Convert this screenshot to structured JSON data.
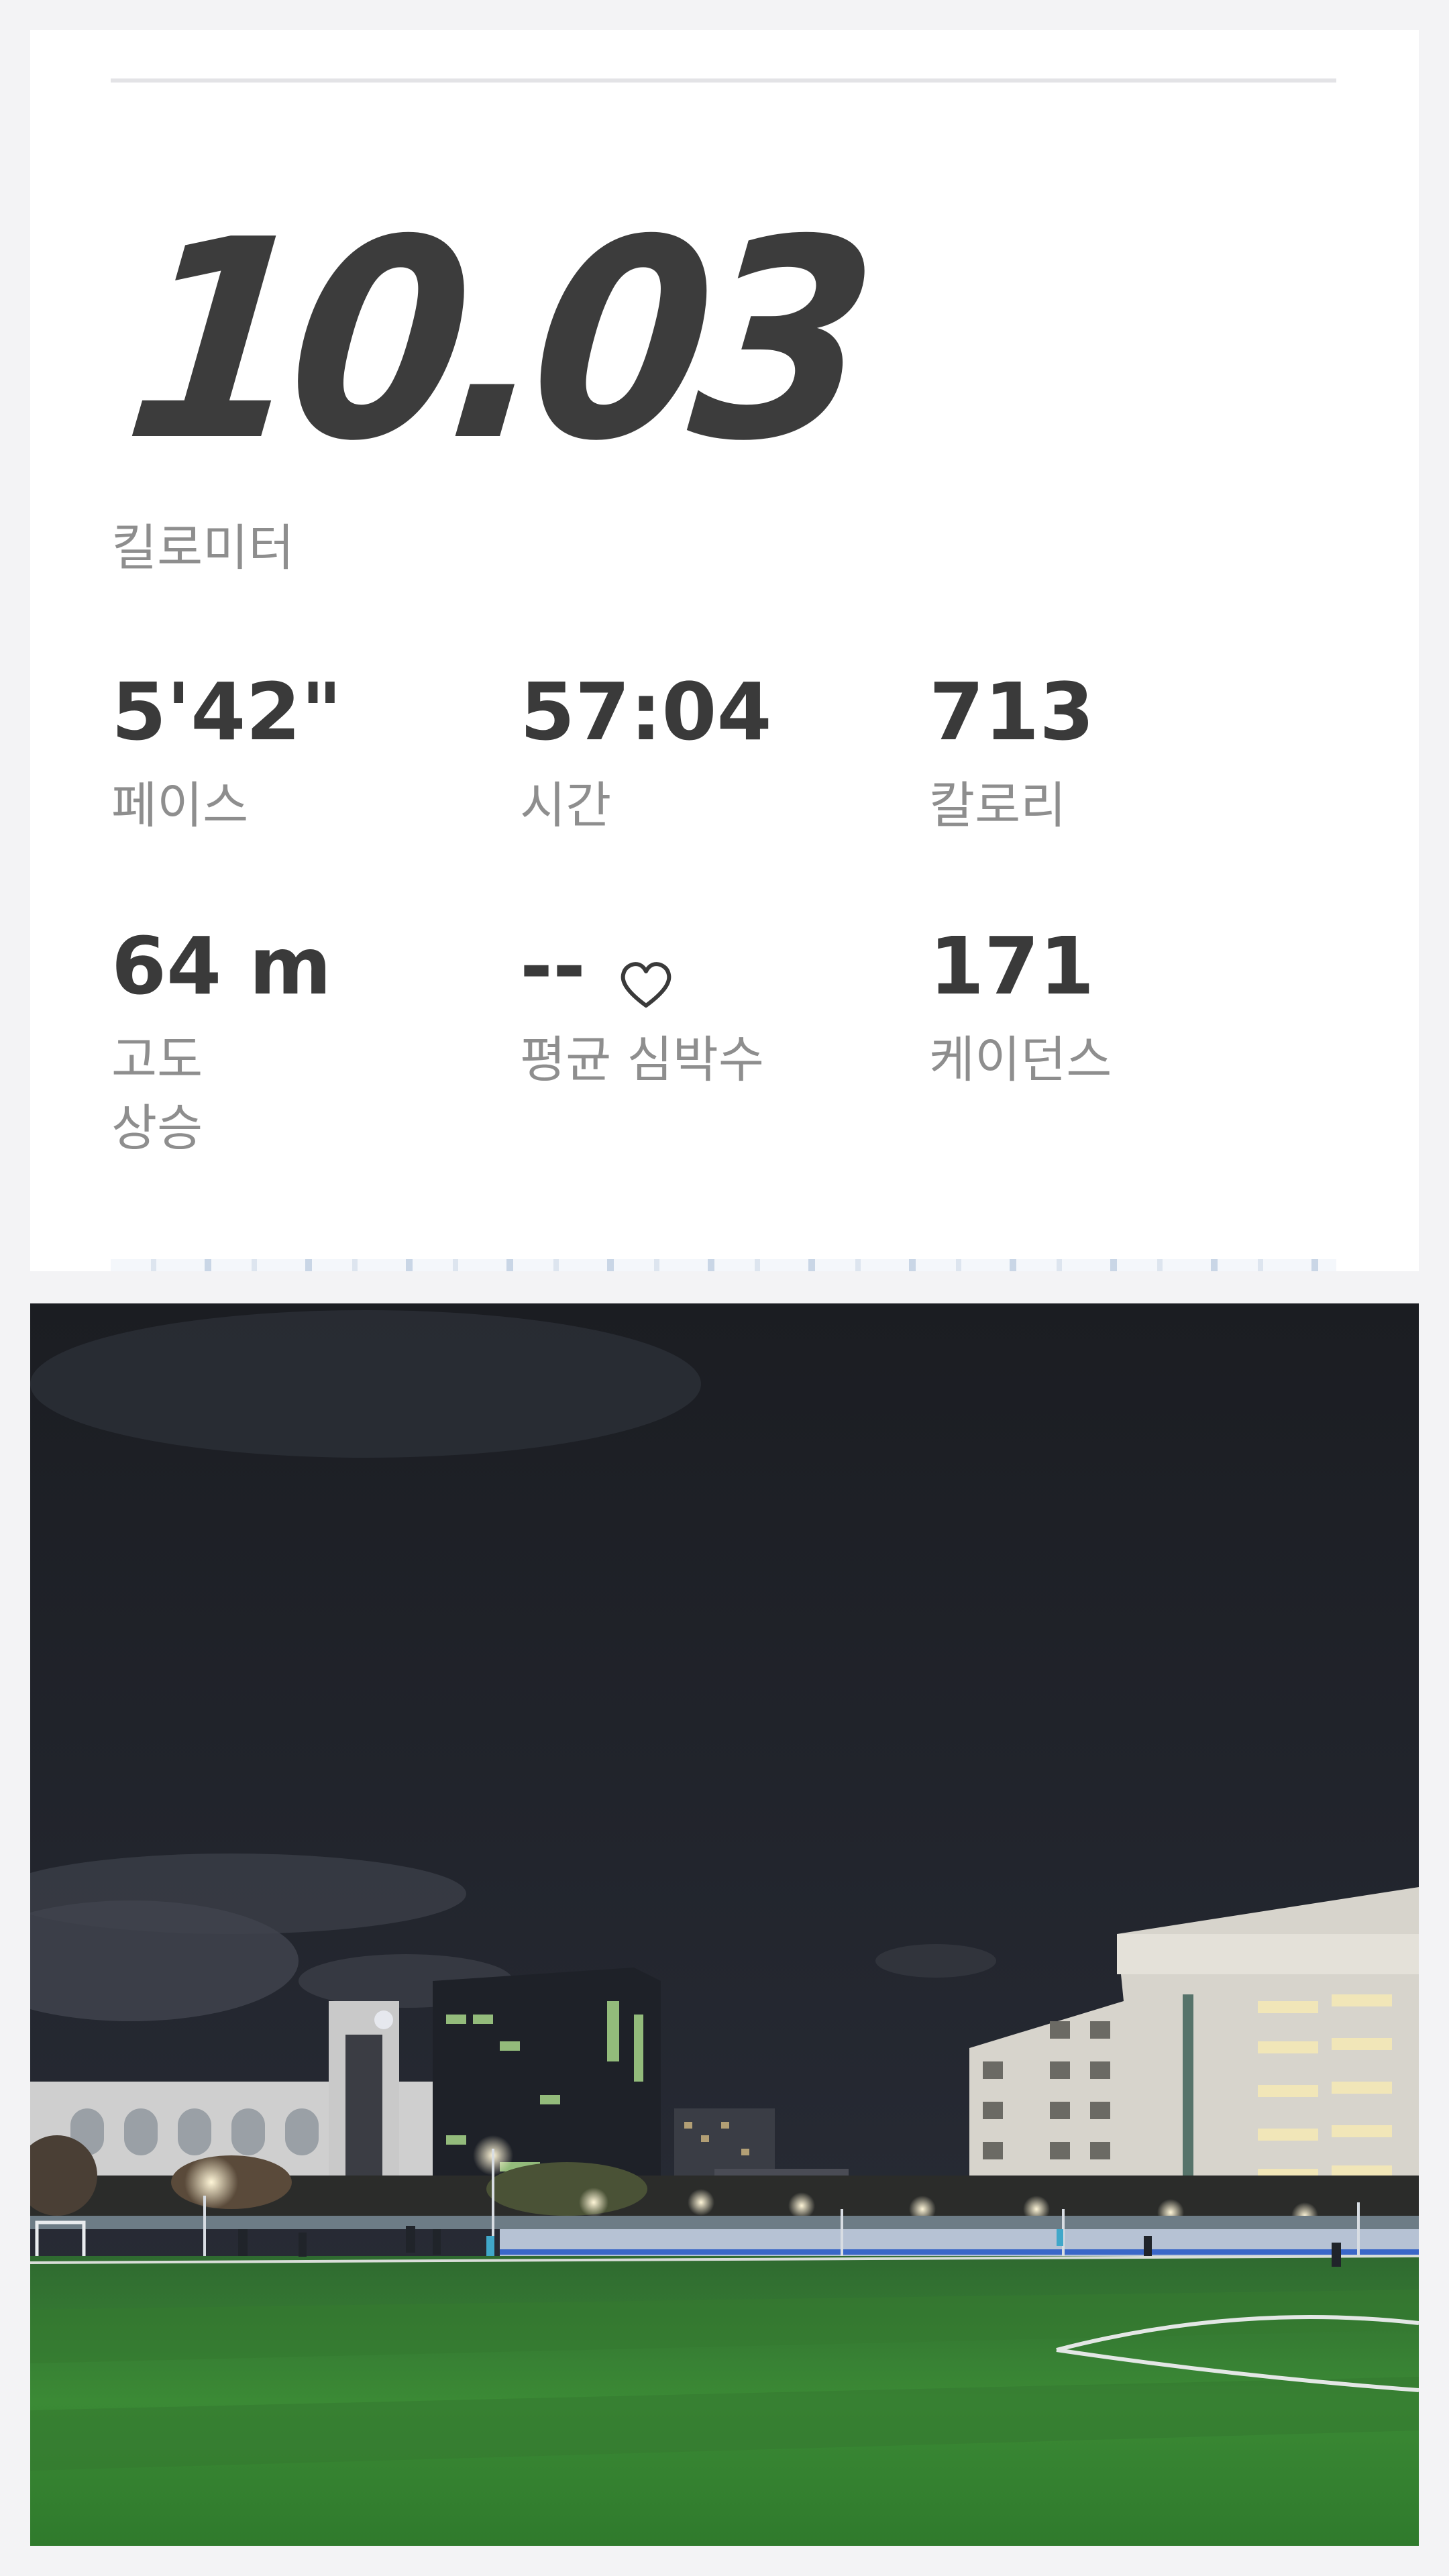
{
  "summary": {
    "distance": "10.03",
    "distance_unit": "킬로미터"
  },
  "stats": [
    {
      "value": "5'42\"",
      "label": "페이스"
    },
    {
      "value": "57:04",
      "label": "시간"
    },
    {
      "value": "713",
      "label": "칼로리"
    },
    {
      "value": "64 m",
      "label": "고도\n상승"
    },
    {
      "value": "--",
      "label": "평균 심박수",
      "icon": "heart-outline-icon"
    },
    {
      "value": "171",
      "label": "케이던스"
    }
  ],
  "colors": {
    "text_primary": "#3a3a3a",
    "text_secondary": "#8e8e8e",
    "card_background": "#ffffff",
    "page_background": "#f3f3f5"
  },
  "photo": {
    "scene": "night-stadium-with-buildings"
  }
}
